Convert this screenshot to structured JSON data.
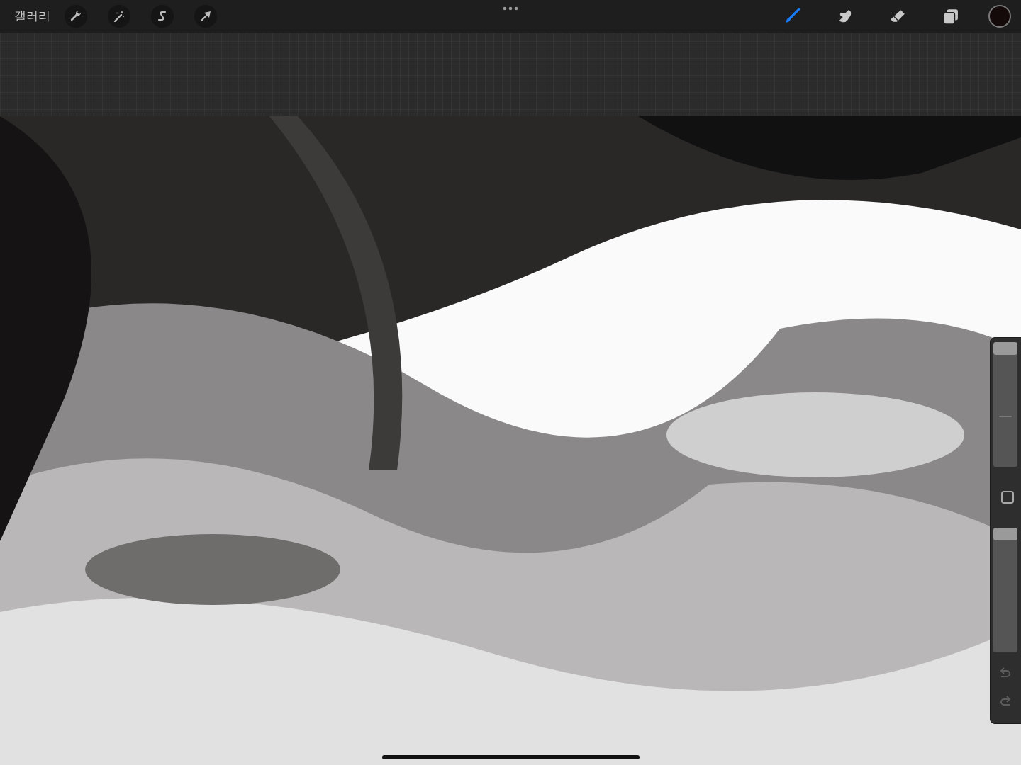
{
  "top_bar": {
    "gallery_label": "갤러리",
    "tools": [
      {
        "kind": "brush",
        "selected": true
      },
      {
        "kind": "smudge",
        "selected": false
      },
      {
        "kind": "eraser",
        "selected": false
      },
      {
        "kind": "layers",
        "selected": false
      }
    ],
    "color_swatch": {
      "color": "#150a0a"
    }
  },
  "sidebar": {
    "size_slider": {
      "level": 1
    },
    "opacity_slider": {
      "level": 1
    },
    "undo": {
      "disabled": true
    },
    "redo": {
      "disabled": true
    }
  }
}
